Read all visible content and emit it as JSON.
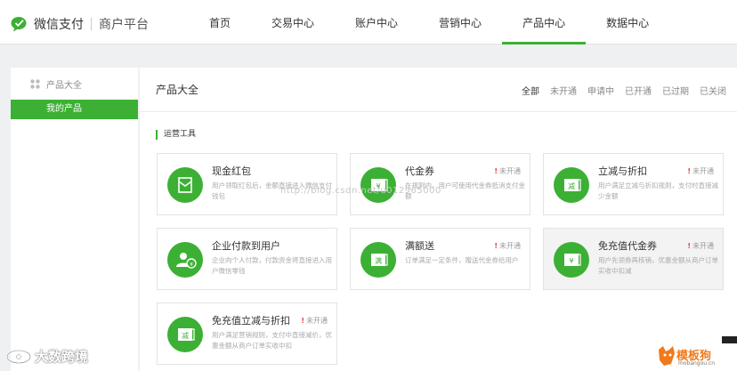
{
  "header": {
    "brand_name": "微信支付",
    "brand_sub": "商户平台",
    "nav": [
      {
        "label": "首页",
        "active": false
      },
      {
        "label": "交易中心",
        "active": false
      },
      {
        "label": "账户中心",
        "active": false
      },
      {
        "label": "营销中心",
        "active": false
      },
      {
        "label": "产品中心",
        "active": true
      },
      {
        "label": "数据中心",
        "active": false
      }
    ]
  },
  "sidebar": {
    "group_title": "产品大全",
    "items": [
      {
        "label": "我的产品",
        "active": true
      }
    ]
  },
  "main": {
    "title": "产品大全",
    "filters": [
      {
        "label": "全部",
        "active": true
      },
      {
        "label": "未开通",
        "active": false
      },
      {
        "label": "申请中",
        "active": false
      },
      {
        "label": "已开通",
        "active": false
      },
      {
        "label": "已过期",
        "active": false
      },
      {
        "label": "已关闭",
        "active": false
      }
    ],
    "section_title": "运营工具",
    "cards": [
      {
        "name": "现金红包",
        "status": "",
        "desc": "用户领取红包后，金额直接进入微信支付钱包",
        "icon": "red-packet-icon"
      },
      {
        "name": "代金券",
        "status": "未开通",
        "desc": "在规则内，用户可使用代金券抵消支付金额",
        "icon": "voucher-icon"
      },
      {
        "name": "立减与折扣",
        "status": "未开通",
        "desc": "用户满足立减与折扣规则，支付时直接减少金额",
        "icon": "discount-icon"
      },
      {
        "name": "企业付款到用户",
        "status": "",
        "desc": "企业向个人付款，付款资金将直接进入用户微信零钱",
        "icon": "payment-icon"
      },
      {
        "name": "满额送",
        "status": "未开通",
        "desc": "订单满足一定条件，赠送代金券给用户",
        "icon": "full-gift-icon"
      },
      {
        "name": "免充值代金券",
        "status": "未开通",
        "desc": "用户先领券再核销，优惠金额从商户订单实收中扣减",
        "icon": "voucher-icon"
      },
      {
        "name": "免充值立减与折扣",
        "status": "未开通",
        "desc": "用户满足营销规则，支付中直接减价，优惠金额从商户订单实收中扣",
        "icon": "discount-icon"
      }
    ]
  },
  "overlays": {
    "watermark": "http://blog.csdn.net/u012965000",
    "corner_logo": "大数跨境",
    "brand_name": "模板狗",
    "brand_url": "mobangou.cn"
  },
  "colors": {
    "accent": "#3cb034",
    "alert": "#e64340",
    "brand_orange": "#f07a1c"
  }
}
